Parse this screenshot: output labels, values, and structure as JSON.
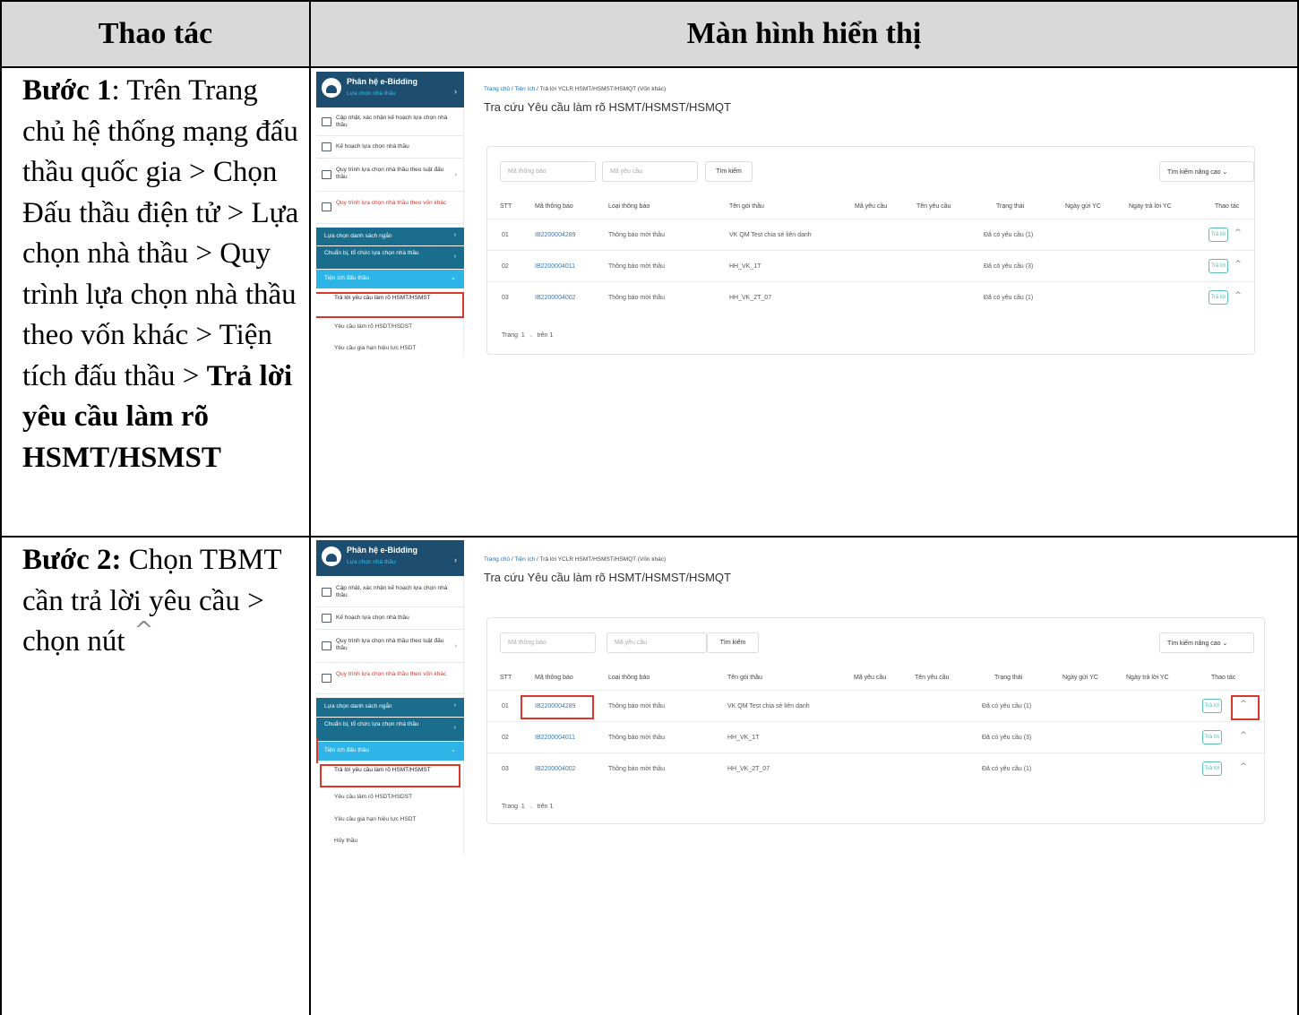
{
  "header": {
    "col1": "Thao tác",
    "col2": "Màn hình hiển thị"
  },
  "steps": [
    {
      "label": "Bước 1",
      "text_1": ": Trên Trang chủ hệ thống mạng đấu thầu quốc gia > Chọn Đấu thầu điện tử > Lựa chọn nhà thầu > Quy trình lựa chọn nhà thầu theo vốn khác > Tiện tích đấu thầu > ",
      "text_bold": "Trả lời yêu cầu làm rõ HSMT/HSMST"
    },
    {
      "label": "Bước 2:",
      "text_1": " Chọn TBMT cần trả lời yêu cầu > chọn nút",
      "caret_icon": "caret-up-icon"
    }
  ],
  "app": {
    "brand_title": "Phân hệ e-Bidding",
    "brand_subtitle": "Lựa chọn nhà thầu",
    "menu": [
      "Cập nhật, xác nhận kế hoạch lựa chọn nhà thầu",
      "Kế hoạch lựa chọn nhà thầu",
      "Quy trình lựa chọn nhà thầu theo luật đấu thầu",
      "Quy trình lựa chọn nhà thầu theo vốn khác"
    ],
    "submenu": [
      "Lựa chọn danh sách ngắn",
      "Chuẩn bị, tổ chức lựa chọn nhà thầu",
      "Tiện ích đấu thầu"
    ],
    "leaves": [
      "Trả lời yêu cầu làm rõ HSMT/HSMST",
      "Yêu cầu làm rõ HSDT/HSDST",
      "Yêu cầu gia hạn hiệu lực HSDT",
      "Hủy thầu"
    ],
    "breadcrumb": {
      "home": "Trang chủ",
      "sep": " / ",
      "utils": "Tiện ích",
      "current": "Trả lời YCLR HSMT/HSMST/HSMQT (Vốn khác)"
    },
    "page_title": "Tra cứu Yêu cầu làm rõ HSMT/HSMST/HSMQT",
    "search": {
      "notice_placeholder": "Mã thông báo",
      "request_placeholder": "Mã yêu cầu",
      "search_button": "Tìm kiếm",
      "advanced_button": "Tìm kiếm nâng cao"
    },
    "columns": [
      "STT",
      "Mã thông báo",
      "Loại thông báo",
      "Tên gói thầu",
      "Mã yêu cầu",
      "Tên yêu cầu",
      "Trạng thái",
      "Ngày gửi YC",
      "Ngày trả lời YC",
      "Thao tác"
    ],
    "rows": [
      {
        "stt": "01",
        "code": "IB2200004289",
        "type": "Thông báo mời thầu",
        "package": "VK QM Test chia sẻ liên danh",
        "status": "Đã có yêu cầu (1)"
      },
      {
        "stt": "02",
        "code": "IB2200004011",
        "type": "Thông báo mời thầu",
        "package": "HH_VK_1T",
        "status": "Đã có yêu cầu (3)"
      },
      {
        "stt": "03",
        "code": "IB2200004002",
        "type": "Thông báo mời thầu",
        "package": "HH_VK_2T_07",
        "status": "Đã có yêu cầu (1)"
      }
    ],
    "reply_button": "Trả lời",
    "pager": {
      "label": "Trang",
      "page": "1",
      "total": "trên 1"
    }
  },
  "colors": {
    "header_bg": "#d9d9d9",
    "brand": "#1d4e6f",
    "submenu_dark": "#1a6d8c",
    "submenu_light": "#2fb4e8",
    "highlight": "#d9362c",
    "reply_button": "#5dbfb3"
  }
}
